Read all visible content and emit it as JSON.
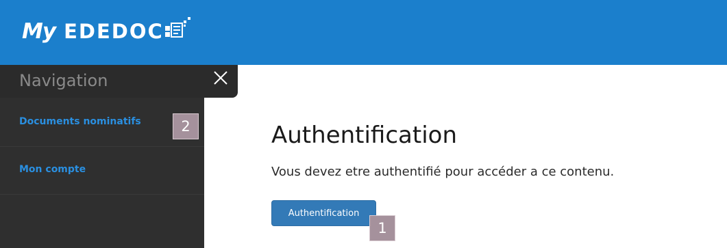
{
  "header": {
    "logo_prefix": "My",
    "logo_name": "EDEDOC",
    "background_color": "#1b7fcc"
  },
  "navigation": {
    "title": "Navigation",
    "close_icon": "close-icon",
    "items": [
      {
        "label": "Documents nominatifs"
      },
      {
        "label": "Mon compte"
      }
    ]
  },
  "main": {
    "title": "Authentification",
    "message": "Vous devez etre authentifié pour accéder a ce contenu.",
    "button_label": "Authentification"
  },
  "annotations": {
    "button_marker": "1",
    "nav_marker": "2"
  },
  "colors": {
    "link": "#2a8fe0",
    "button": "#337ab7",
    "sidebar": "#2f2f2f",
    "marker": "#a5919c"
  }
}
